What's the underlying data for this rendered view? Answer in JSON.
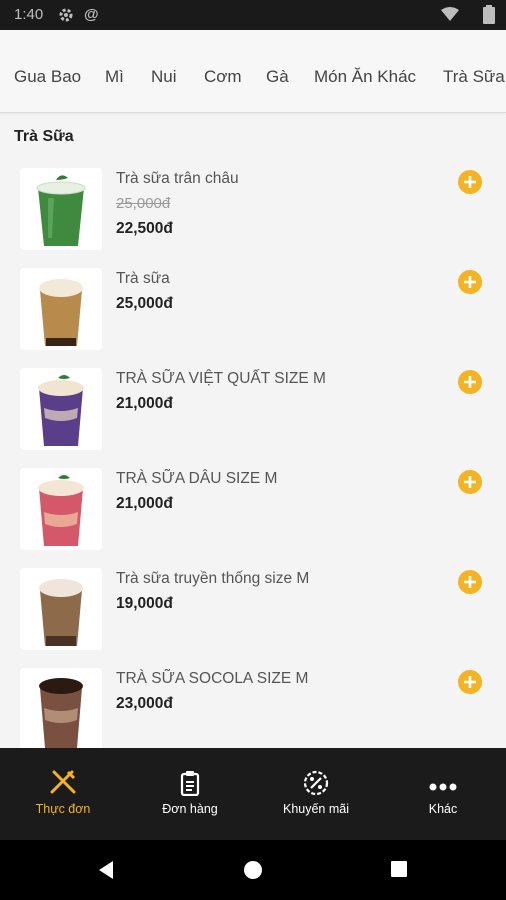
{
  "status_bar": {
    "time": "1:40",
    "at_symbol": "@"
  },
  "categories": [
    "Gua Bao",
    "Mì",
    "Nui",
    "Cơm",
    "Gà",
    "Món Ăn Khác",
    "Trà Sữa"
  ],
  "section": {
    "title": "Trà Sữa"
  },
  "products": [
    {
      "name": "Trà sữa trân châu",
      "old_price": "25,000đ",
      "price": "22,500đ",
      "drink_color": "#3f8a3f",
      "topping_color": "#2e7d32",
      "has_mint": true
    },
    {
      "name": "Trà sữa",
      "old_price": "",
      "price": "25,000đ",
      "drink_color": "#b88a4c",
      "topping_color": "#f2e9d8",
      "has_mint": false
    },
    {
      "name": "TRÀ SỮA VIỆT QUẤT SIZE M",
      "old_price": "",
      "price": "21,000đ",
      "drink_color": "#5b3e8a",
      "topping_color": "#f1e4d0",
      "has_mint": true
    },
    {
      "name": "TRÀ SỮA DÂU SIZE M",
      "old_price": "",
      "price": "21,000đ",
      "drink_color": "#d4586a",
      "topping_color": "#f4e6d4",
      "has_mint": true
    },
    {
      "name": "Trà sữa truyền thống size M",
      "old_price": "",
      "price": "19,000đ",
      "drink_color": "#8c6a4a",
      "topping_color": "#efe5d8",
      "has_mint": false
    },
    {
      "name": "TRÀ SỮA SOCOLA SIZE M",
      "old_price": "",
      "price": "23,000đ",
      "drink_color": "#7a5040",
      "topping_color": "#2a1a12",
      "has_mint": false
    }
  ],
  "bottom_nav": [
    {
      "label": "Thực đơn",
      "icon": "utensils-icon",
      "active": true
    },
    {
      "label": "Đơn hàng",
      "icon": "clipboard-icon",
      "active": false
    },
    {
      "label": "Khuyến mãi",
      "icon": "discount-badge-icon",
      "active": false
    },
    {
      "label": "Khác",
      "icon": "more-dots-icon",
      "active": false
    }
  ],
  "colors": {
    "accent": "#f4b324",
    "nav_bg": "#1b1b1b",
    "page_bg": "#f4f4f4"
  }
}
